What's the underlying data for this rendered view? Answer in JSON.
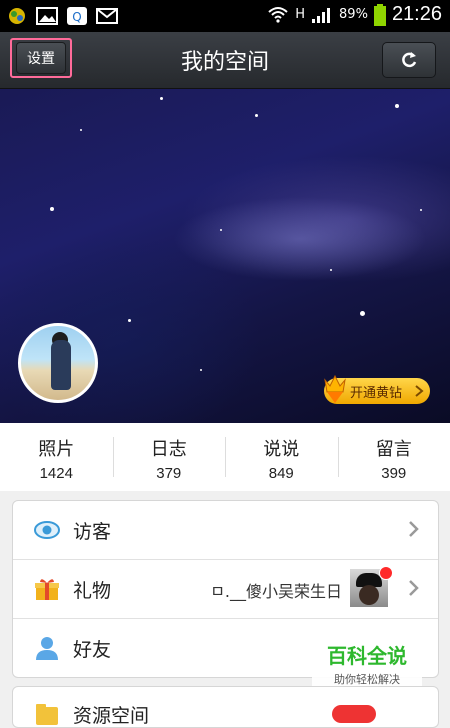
{
  "status_bar": {
    "left_icons": [
      "app-icon",
      "image-icon",
      "qq-icon",
      "mail-icon"
    ],
    "network": "H",
    "battery": "89%",
    "time": "21:26"
  },
  "header": {
    "settings_label": "设置",
    "title": "我的空间",
    "refresh_icon": "refresh-icon"
  },
  "cover": {
    "vip_label": "开通黄钻"
  },
  "stats": [
    {
      "label": "照片",
      "value": "1424"
    },
    {
      "label": "日志",
      "value": "379"
    },
    {
      "label": "说说",
      "value": "849"
    },
    {
      "label": "留言",
      "value": "399"
    }
  ],
  "menu": {
    "visitors": {
      "label": "访客",
      "icon": "eye-icon"
    },
    "gifts": {
      "label": "礼物",
      "icon": "gift-icon",
      "detail": "ㅁ.__傻小吴荣生日"
    },
    "friends": {
      "label": "好友",
      "icon": "person-icon"
    },
    "next": {
      "label": "资源空间"
    }
  },
  "watermark": {
    "title": "百科全说",
    "subtitle": "助你轻松解决"
  },
  "colors": {
    "highlight_border": "#ff6b9a",
    "vip_gold": "#f0a800",
    "watermark_green": "#2eb82e"
  }
}
